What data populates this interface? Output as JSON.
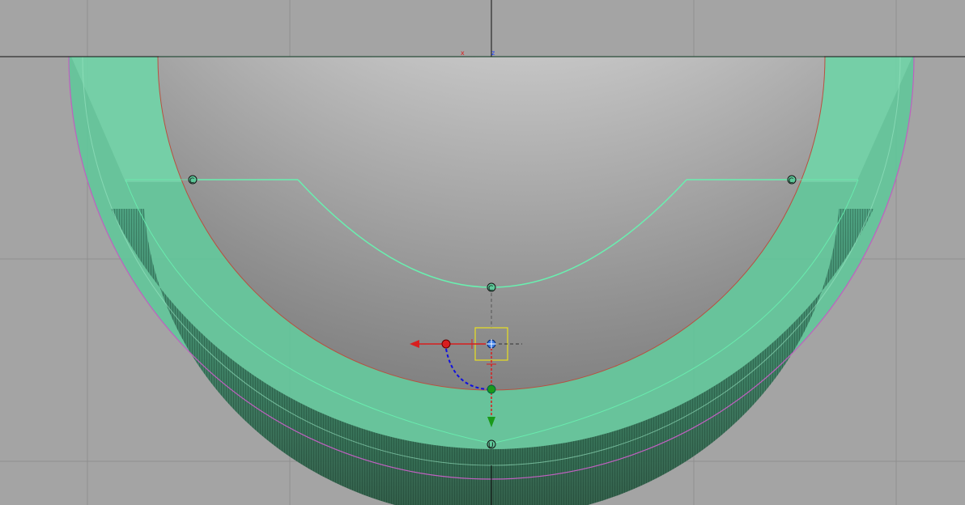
{
  "viewport": {
    "background": "#a4a4a4",
    "grid_color": "#8f8f8f",
    "axis_line_color": "#111111",
    "axis_labels": {
      "x": "x",
      "z": "z"
    },
    "axis_label_colors": {
      "x": "#d81e1e",
      "z": "#2040ff"
    }
  },
  "model": {
    "outer_shell_color": "#5ec99a",
    "inner_surface_color": "#c4c4c4",
    "rim_outline_color": "#c060c0",
    "inner_edge_color": "#b85040",
    "profile_curve_color": "#69f0b0"
  },
  "gizmo": {
    "x_axis_color": "#d81e1e",
    "y_axis_color": "#1a9a1a",
    "rotation_arc_color": "#1010e0",
    "pivot_color": "#3a7ce8",
    "selection_box_color": "#e8e020"
  },
  "profile_points": [
    {
      "id": "left",
      "glyph": "C"
    },
    {
      "id": "right",
      "glyph": "C"
    },
    {
      "id": "center",
      "glyph": "C"
    },
    {
      "id": "bottom",
      "glyph": "U"
    }
  ]
}
